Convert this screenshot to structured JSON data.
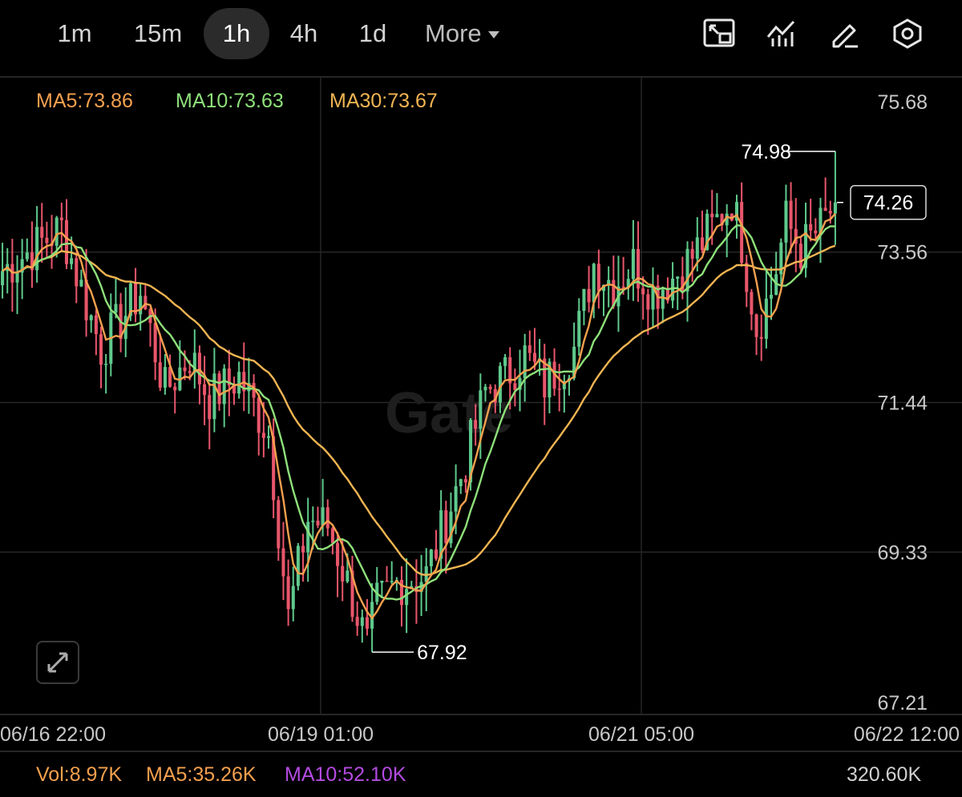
{
  "timeframes": [
    {
      "label": "1m",
      "active": false
    },
    {
      "label": "15m",
      "active": false
    },
    {
      "label": "1h",
      "active": true
    },
    {
      "label": "4h",
      "active": false
    },
    {
      "label": "1d",
      "active": false
    }
  ],
  "more_label": "More",
  "tools": [
    "fullscreen-icon",
    "indicator-icon",
    "draw-pencil-icon",
    "settings-icon"
  ],
  "ma_legend": {
    "ma5": "MA5:73.86",
    "ma10": "MA10:73.63",
    "ma30": "MA30:73.67"
  },
  "volume_legend": {
    "vol": "Vol:8.97K",
    "ma5": "MA5:35.26K",
    "ma10": "MA10:52.10K",
    "max": "320.60K"
  },
  "watermark": "Gate",
  "colors": {
    "up": "#5fc98c",
    "down": "#e8566b",
    "ma5": "#f5a04e",
    "ma10": "#8ee07a",
    "ma30": "#f2b552",
    "ma10_vol": "#b44be1",
    "background": "#000000",
    "grid": "#262626",
    "axis_text": "#c8c8c8"
  },
  "chart_data": {
    "type": "candlestick",
    "interval": "1h",
    "x_tick_labels": [
      "06/16 22:00",
      "06/19 01:00",
      "06/21 05:00",
      "06/22 12:00"
    ],
    "y_tick_labels": [
      75.68,
      73.56,
      71.44,
      69.33,
      67.21
    ],
    "ylim": [
      67.21,
      75.68
    ],
    "last_price": 74.26,
    "high_marker": 74.98,
    "low_marker": 67.92,
    "grid": true,
    "ma_close_anchors": [
      [
        0,
        73.3
      ],
      [
        12,
        73.9
      ],
      [
        20,
        72.2
      ],
      [
        28,
        73.0
      ],
      [
        33,
        71.6
      ],
      [
        38,
        72.1
      ],
      [
        42,
        71.5
      ],
      [
        48,
        71.8
      ],
      [
        54,
        71.0
      ],
      [
        58,
        68.4
      ],
      [
        62,
        69.8
      ],
      [
        66,
        69.7
      ],
      [
        70,
        68.9
      ],
      [
        74,
        68.0
      ],
      [
        76,
        68.6
      ],
      [
        80,
        68.9
      ],
      [
        86,
        69.0
      ],
      [
        90,
        69.8
      ],
      [
        94,
        70.6
      ],
      [
        98,
        71.6
      ],
      [
        102,
        71.8
      ],
      [
        106,
        72.1
      ],
      [
        110,
        71.7
      ],
      [
        116,
        72.2
      ],
      [
        120,
        73.4
      ],
      [
        124,
        73.1
      ],
      [
        128,
        73.4
      ],
      [
        132,
        73.0
      ],
      [
        136,
        73.2
      ],
      [
        140,
        73.5
      ],
      [
        144,
        73.9
      ],
      [
        148,
        74.3
      ],
      [
        150,
        73.7
      ],
      [
        153,
        72.5
      ],
      [
        156,
        73.0
      ],
      [
        159,
        74.0
      ],
      [
        162,
        73.6
      ],
      [
        166,
        73.9
      ],
      [
        169,
        74.25
      ]
    ]
  }
}
